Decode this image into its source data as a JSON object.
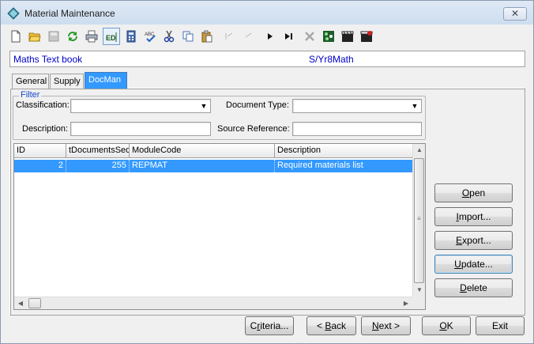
{
  "window": {
    "title": "Material Maintenance",
    "close_glyph": "✕"
  },
  "toolbar": {
    "items": [
      {
        "icon": "new-document-icon"
      },
      {
        "icon": "open-folder-icon"
      },
      {
        "icon": "save-icon"
      },
      {
        "icon": "refresh-icon"
      },
      {
        "icon": "print-icon"
      },
      {
        "icon": "edit-mode-icon",
        "label": "ED"
      },
      {
        "icon": "calculator-icon"
      },
      {
        "icon": "spellcheck-icon",
        "label": "ABC"
      },
      {
        "icon": "cut-icon"
      },
      {
        "icon": "copy-icon"
      },
      {
        "icon": "paste-icon"
      },
      {
        "icon": "first-record-icon"
      },
      {
        "icon": "previous-record-icon"
      },
      {
        "icon": "next-record-icon"
      },
      {
        "icon": "last-record-icon"
      },
      {
        "icon": "delete-icon"
      },
      {
        "icon": "attach-icon"
      },
      {
        "icon": "clapperboard-icon"
      },
      {
        "icon": "clapperboard-edit-icon"
      }
    ]
  },
  "record": {
    "name": "Maths Text book",
    "code": "S/Yr8Math"
  },
  "tabs": [
    {
      "label": "General"
    },
    {
      "label": "Supply"
    },
    {
      "label": "DocMan"
    }
  ],
  "filter": {
    "legend": "Filter",
    "classification_label": "Classification:",
    "classification_value": "",
    "document_type_label": "Document Type:",
    "document_type_value": "",
    "description_label": "Description:",
    "description_value": "",
    "source_reference_label": "Source Reference:",
    "source_reference_value": ""
  },
  "grid": {
    "columns": [
      "ID",
      "tDocumentsSeq",
      "ModuleCode",
      "Description"
    ],
    "rows": [
      {
        "id": "2",
        "seq": "255",
        "module_code": "REPMAT",
        "description": "Required materials list"
      }
    ]
  },
  "side_buttons": {
    "open": {
      "mnemonic": "O",
      "rest": "pen"
    },
    "import": {
      "mnemonic": "I",
      "rest": "mport..."
    },
    "export": {
      "mnemonic": "E",
      "rest": "xport..."
    },
    "update": {
      "mnemonic": "U",
      "rest": "pdate..."
    },
    "delete": {
      "mnemonic": "D",
      "rest": "elete"
    }
  },
  "footer_buttons": {
    "criteria": {
      "pre": "C",
      "mnemonic": "r",
      "rest": "iteria..."
    },
    "back": {
      "pre": "< ",
      "mnemonic": "B",
      "rest": "ack"
    },
    "next": {
      "pre": "",
      "mnemonic": "N",
      "rest": "ext >"
    },
    "ok": {
      "pre": "",
      "mnemonic": "O",
      "rest": "K"
    },
    "exit": {
      "label": "Exit"
    }
  }
}
